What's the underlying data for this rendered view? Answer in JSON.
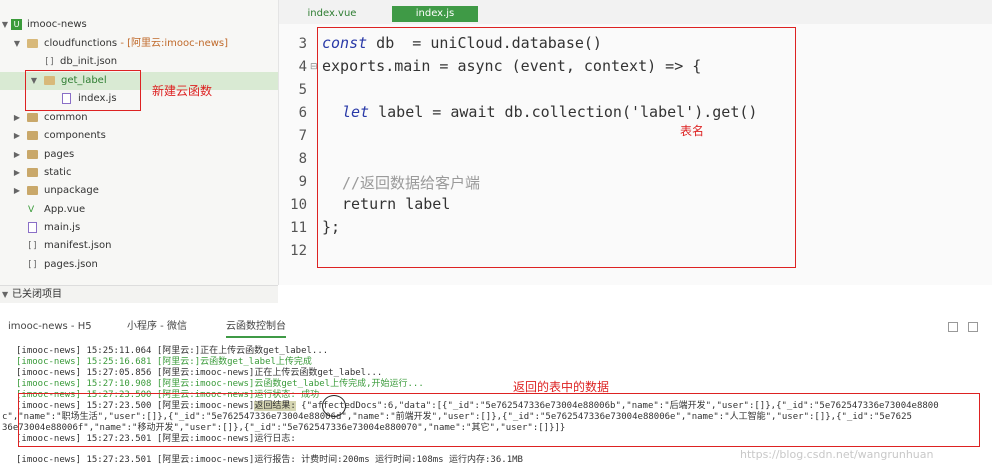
{
  "sidebar": {
    "project": "imooc-news",
    "items": [
      {
        "label": "cloudfunctions",
        "suffix": " - [阿里云:imooc-news]"
      },
      {
        "label": "db_init.json"
      },
      {
        "label": "get_label"
      },
      {
        "label": "index.js"
      },
      {
        "label": "common"
      },
      {
        "label": "components"
      },
      {
        "label": "pages"
      },
      {
        "label": "static"
      },
      {
        "label": "unpackage"
      },
      {
        "label": "App.vue"
      },
      {
        "label": "main.js"
      },
      {
        "label": "manifest.json"
      },
      {
        "label": "pages.json"
      }
    ],
    "closed_projects": "已关闭项目"
  },
  "editor": {
    "tabs": [
      {
        "label": "index.vue"
      },
      {
        "label": "index.js"
      }
    ],
    "line_numbers": [
      "3",
      "4",
      "5",
      "6",
      "7",
      "8",
      "9",
      "10",
      "11",
      "12"
    ],
    "code": {
      "l3_kw": "const",
      "l3_rest": " db  = uniCloud.database()",
      "l4": "exports.main = async (event, context) => {",
      "l6_kw": "let",
      "l6_rest": " label = await db.collection('label').get()",
      "l9": "//返回数据给客户端",
      "l10_kw": "return",
      "l10_rest": " label",
      "l11": "};"
    }
  },
  "annotations": {
    "new_cloud_function": "新建云函数",
    "table_name": "表名",
    "returned_data": "返回的表中的数据"
  },
  "panel": {
    "tabs": [
      {
        "label": "imooc-news - H5"
      },
      {
        "label": "小程序 - 微信"
      },
      {
        "label": "云函数控制台"
      }
    ]
  },
  "log": {
    "lines": [
      "[imooc-news] 15:25:11.064 [阿里云:]正在上传云函数get_label...",
      "[imooc-news] 15:25:16.681 [阿里云:]云函数get_label上传完成",
      "[imooc-news] 15:27:05.856 [阿里云:imooc-news]正在上传云函数get_label...",
      "[imooc-news] 15:27:10.908 [阿里云:imooc-news]云函数get_label上传完成,开始运行...",
      "[imooc-news] 15:27:23.500 [阿里云:imooc-news]运行状态: 成功",
      "[imooc-news] 15:27:23.500 [阿里云:imooc-news]",
      "返回结果:",
      " {\"affectedDocs\":6,\"data\":[{\"_id\":\"5e762547336e73004e88006b\",\"name\":\"后端开发\",\"user\":[]},{\"_id\":\"5e762547336e73004e8800",
      "c\",\"name\":\"职场生活\",\"user\":[]},{\"_id\":\"5e762547336e73004e88006d\",\"name\":\"前端开发\",\"user\":[]},{\"_id\":\"5e762547336e73004e88006e\",\"name\":\"人工智能\",\"user\":[]},{\"_id\":\"5e7625",
      "36e73004e88006f\",\"name\":\"移动开发\",\"user\":[]},{\"_id\":\"5e762547336e73004e880070\",\"name\":\"其它\",\"user\":[]}]}",
      "[imooc-news] 15:27:23.501 [阿里云:imooc-news]运行日志:",
      "[imooc-news] 15:27:23.501 [阿里云:imooc-news]运行报告: 计费时间:200ms 运行时间:108ms 运行内存:36.1MB"
    ]
  },
  "watermark": "https://blog.csdn.net/wangrunhuan"
}
